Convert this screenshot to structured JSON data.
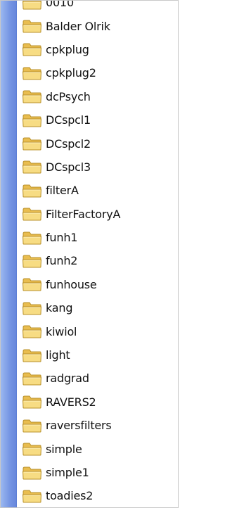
{
  "folders": [
    {
      "name": "0010"
    },
    {
      "name": "Balder Olrik"
    },
    {
      "name": "cpkplug"
    },
    {
      "name": "cpkplug2"
    },
    {
      "name": "dcPsych"
    },
    {
      "name": "DCspcl1"
    },
    {
      "name": "DCspcl2"
    },
    {
      "name": "DCspcl3"
    },
    {
      "name": "filterA"
    },
    {
      "name": "FilterFactoryA"
    },
    {
      "name": "funh1"
    },
    {
      "name": "funh2"
    },
    {
      "name": "funhouse"
    },
    {
      "name": "kang"
    },
    {
      "name": "kiwiol"
    },
    {
      "name": "light"
    },
    {
      "name": "radgrad"
    },
    {
      "name": "RAVERS2"
    },
    {
      "name": "raversfilters"
    },
    {
      "name": "simple"
    },
    {
      "name": "simple1"
    },
    {
      "name": "toadies2"
    }
  ],
  "icon": "folder-icon",
  "colors": {
    "sidebar": "#7797e4",
    "folder_fill": "#f5d77a",
    "folder_stroke": "#b8902a"
  }
}
